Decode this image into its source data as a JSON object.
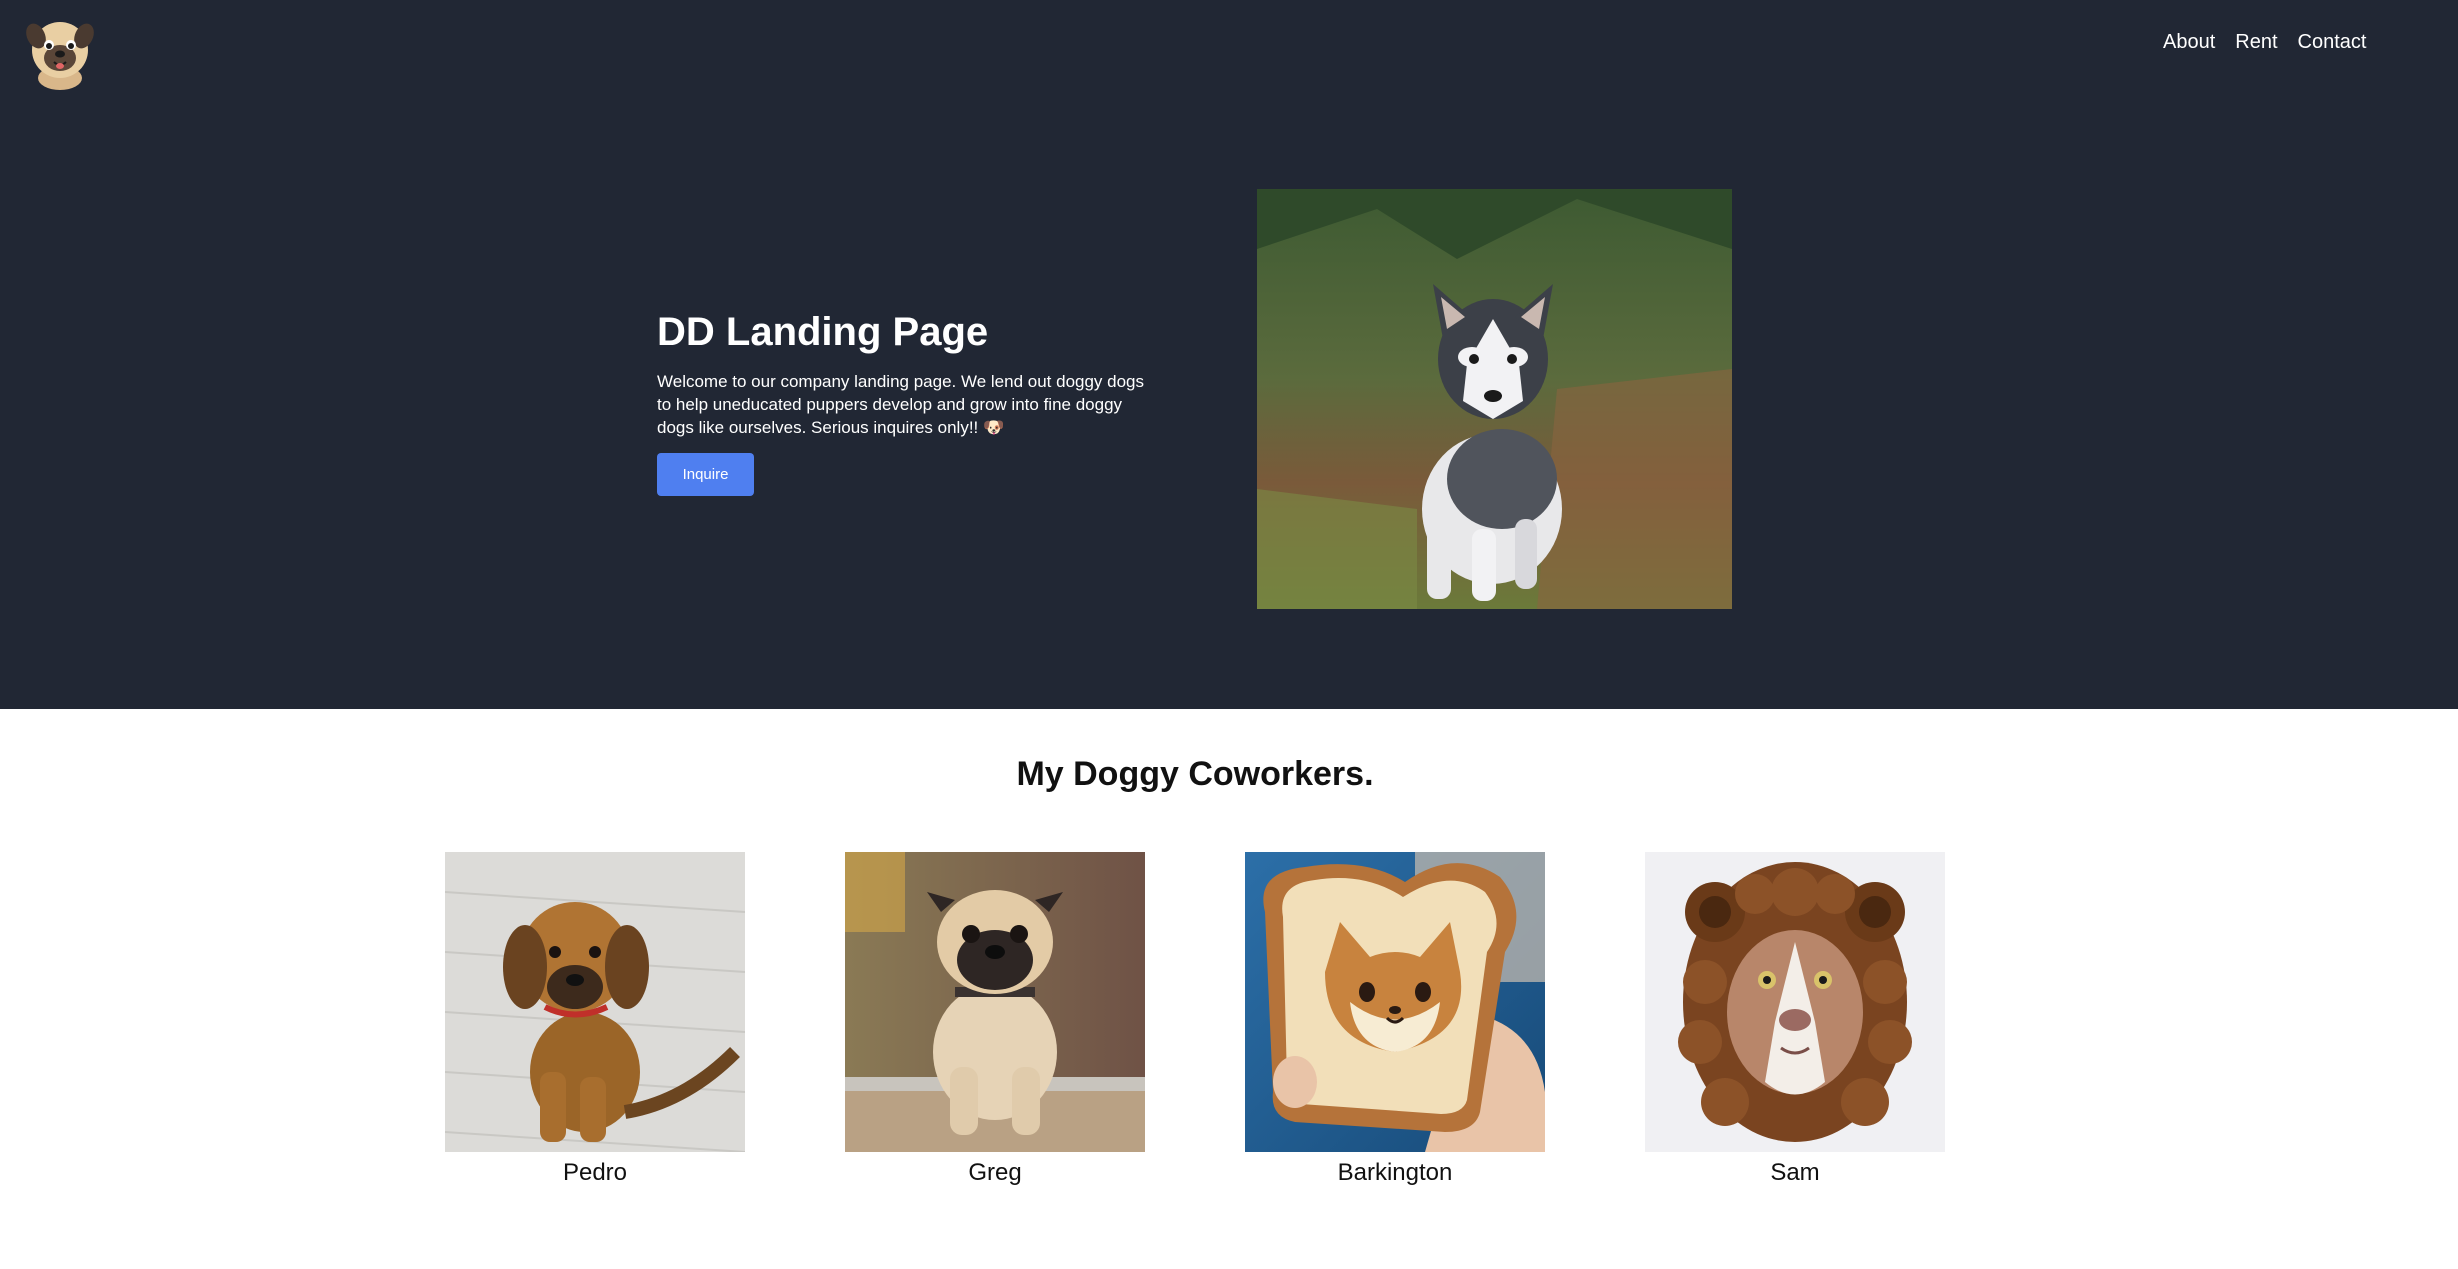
{
  "header": {
    "logo_icon": "pug-logo-icon",
    "nav": [
      {
        "label": "About"
      },
      {
        "label": "Rent"
      },
      {
        "label": "Contact"
      }
    ]
  },
  "hero": {
    "title": "DD Landing Page",
    "description": "Welcome to our company landing page. We lend out doggy dogs to help uneducated puppers develop and grow into fine doggy dogs like ourselves. Serious inquires only!! 🐶",
    "button_label": "Inquire",
    "button_color": "#4f7ff0",
    "background_color": "#212734",
    "image": "husky-puppy-photo"
  },
  "coworkers": {
    "title": "My Doggy Coworkers.",
    "items": [
      {
        "name": "Pedro",
        "image": "brown-puppy-photo"
      },
      {
        "name": "Greg",
        "image": "pug-photo"
      },
      {
        "name": "Barkington",
        "image": "toast-dog-photo"
      },
      {
        "name": "Sam",
        "image": "lion-costume-dog-photo"
      }
    ]
  }
}
